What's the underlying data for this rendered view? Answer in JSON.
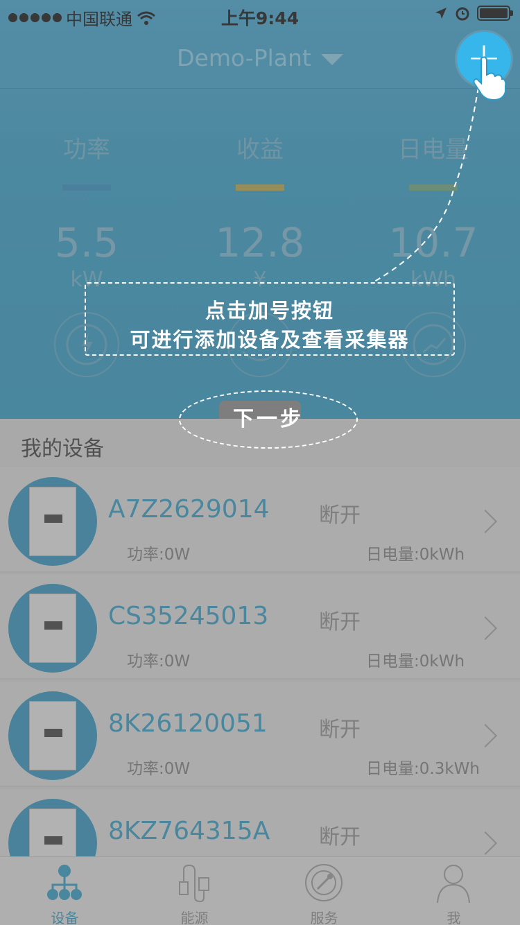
{
  "status_bar": {
    "carrier": "中国联通",
    "time": "上午9:44"
  },
  "nav": {
    "title": "Demo-Plant",
    "add_button": "+"
  },
  "stats": [
    {
      "label": "功率",
      "value": "5.5",
      "unit": "kW",
      "bar_color": "#2d8fc0",
      "icon": "lightning-gauge-icon"
    },
    {
      "label": "收益",
      "value": "12.8",
      "unit": "¥",
      "bar_color": "#b7a84a",
      "icon": "revenue-icon"
    },
    {
      "label": "日电量",
      "value": "10.7",
      "unit": "kWh",
      "bar_color": "#6aa87e",
      "icon": "trend-chart-icon"
    }
  ],
  "devices_section": {
    "title": "我的设备"
  },
  "devices": [
    {
      "sn": "A7Z2629014",
      "status": "断开",
      "power": "功率:0W",
      "energy": "日电量:0kWh"
    },
    {
      "sn": "CS35245013",
      "status": "断开",
      "power": "功率:0W",
      "energy": "日电量:0kWh"
    },
    {
      "sn": "8K26120051",
      "status": "断开",
      "power": "功率:0W",
      "energy": "日电量:0.3kWh"
    },
    {
      "sn": "8KZ764315A",
      "status": "断开",
      "power": "",
      "energy": ""
    }
  ],
  "tabs": [
    {
      "label": "设备",
      "icon": "devices-tree-icon",
      "active": true
    },
    {
      "label": "能源",
      "icon": "energy-plug-icon",
      "active": false
    },
    {
      "label": "服务",
      "icon": "service-compass-icon",
      "active": false
    },
    {
      "label": "我",
      "icon": "user-icon",
      "active": false
    }
  ],
  "guide": {
    "line1": "点击加号按钮",
    "line2": "可进行添加设备及查看采集器",
    "next_step": "下一步"
  },
  "colors": {
    "brand": "#2b9bc6",
    "header": "#3aa3d0",
    "add_button": "#37b6ec"
  }
}
